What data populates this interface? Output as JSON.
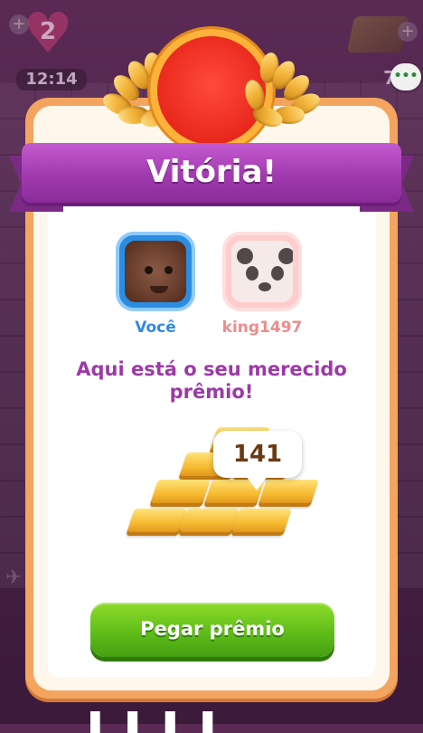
{
  "hud": {
    "lives_count": "2",
    "timer": "12:14",
    "gold_count": "72",
    "plus_label": "+"
  },
  "more_button": {
    "label": "•••"
  },
  "dialog": {
    "title": "Vitória!",
    "player_you": {
      "name": "Você"
    },
    "player_opponent": {
      "name": "king1497"
    },
    "message": "Aqui está o seu merecido prêmio!",
    "reward_amount": "141",
    "claim_button_label": "Pegar prêmio"
  },
  "colors": {
    "ribbon": "#a13aaf",
    "card_border": "#f3a55f",
    "button_green": "#63c01a",
    "message_purple": "#9c3aa6",
    "you_blue": "#2f8be0",
    "opponent_pink": "#ee8c8c",
    "medal_red": "#e8281c"
  },
  "icons": {
    "heart": "heart-icon",
    "gold": "gold-bars-icon",
    "plane": "plane-icon",
    "laurel": "laurel-icon",
    "medal": "medal-icon"
  }
}
